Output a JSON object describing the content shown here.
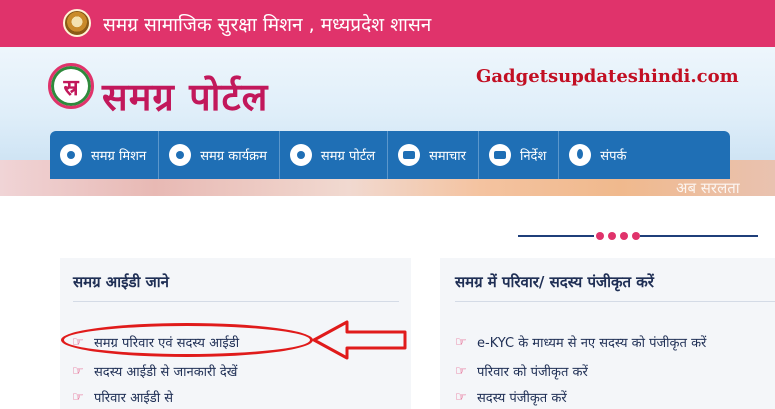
{
  "topbar": {
    "title": "समग्र सामाजिक सुरक्षा मिशन , मध्यप्रदेश शासन"
  },
  "logo": {
    "mark": "स्र",
    "text": "समग्र पोर्टल"
  },
  "watermark": "Gadgetsupdateshindi.com",
  "nav": {
    "items": [
      {
        "label": "समग्र मिशन",
        "icon": "circle-icon"
      },
      {
        "label": "समग्र कार्यक्रम",
        "icon": "circle-icon"
      },
      {
        "label": "समग्र पोर्टल",
        "icon": "circle-icon"
      },
      {
        "label": "समाचार",
        "icon": "news-icon"
      },
      {
        "label": "निर्देश",
        "icon": "list-icon"
      },
      {
        "label": "संपर्क",
        "icon": "location-pin-icon"
      }
    ]
  },
  "banner_text": "अब सरलता",
  "left_panel": {
    "title": "समग्र आईडी जाने",
    "links": [
      "समग्र परिवार एवं सदस्य आईडी",
      "सदस्य आईडी से जानकारी देखें",
      "परिवार आईडी से"
    ]
  },
  "right_panel": {
    "title": "समग्र में परिवार/ सदस्य पंजीकृत करें",
    "links": [
      "e-KYC के माध्यम से नए सदस्य को पंजीकृत करें",
      "परिवार को पंजीकृत करें",
      "सदस्य पंजीकृत करें"
    ]
  },
  "colors": {
    "topbar": "#e0336b",
    "nav": "#1f6fb5",
    "title_text": "#1f2f55",
    "accent": "#e0336b",
    "annotation": "#e01b1b"
  }
}
